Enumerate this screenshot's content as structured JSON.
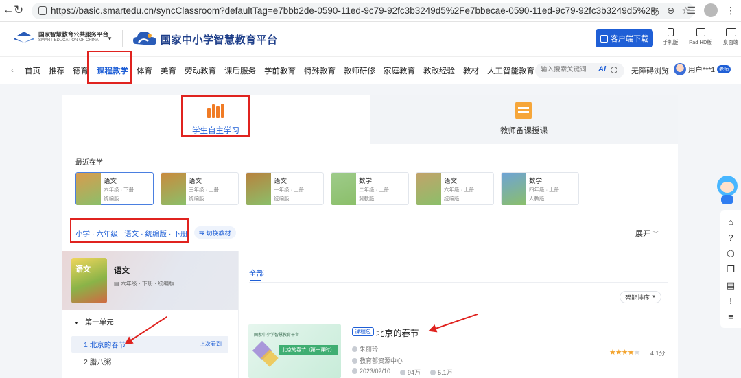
{
  "browser": {
    "url": "https://basic.smartedu.cn/syncClassroom?defaultTag=e7bbb2de-0590-11ed-9c79-92fc3b3249d5%2Fe7bbecae-0590-11ed-9c79-92fc3b3249d5%2F6a7496..."
  },
  "header": {
    "small_logo_cn": "国家智慧教育公共服务平台",
    "small_logo_en": "SMART EDUCATION OF CHINA",
    "main_title": "国家中小学智慧教育平台",
    "download_label": "客户端下载",
    "devices": [
      {
        "label": "手机版"
      },
      {
        "label": "Pad HD版"
      },
      {
        "label": "桌面端"
      }
    ]
  },
  "nav": {
    "items": [
      "首页",
      "推荐",
      "德育",
      "课程教学",
      "体育",
      "美育",
      "劳动教育",
      "课后服务",
      "学前教育",
      "特殊教育",
      "教师研修",
      "家庭教育",
      "教改经验",
      "教材",
      "人工智能教育"
    ],
    "active_index": 3,
    "search_placeholder": "输入搜索关键词",
    "ai_label": "Ai",
    "accessibility": "无障碍浏览",
    "user_name": "用户***1",
    "user_badge": "老师"
  },
  "tabs": {
    "student": "学生自主学习",
    "teacher": "教师备课授课"
  },
  "recent": {
    "title": "最近在学",
    "items": [
      {
        "subject": "语文",
        "grade": "六年级 · 下册",
        "edition": "统编版",
        "color": "#d99b4e"
      },
      {
        "subject": "语文",
        "grade": "三年级 · 上册",
        "edition": "统编版",
        "color": "#c98a3d"
      },
      {
        "subject": "语文",
        "grade": "一年级 · 上册",
        "edition": "统编版",
        "color": "#b8823e"
      },
      {
        "subject": "数学",
        "grade": "二年级 · 上册",
        "edition": "冀教版",
        "color": "#9ecb8a"
      },
      {
        "subject": "语文",
        "grade": "六年级 · 上册",
        "edition": "统编版",
        "color": "#c2a36a"
      },
      {
        "subject": "数学",
        "grade": "四年级 · 上册",
        "edition": "人教版",
        "color": "#6ea3d6"
      }
    ]
  },
  "filter": {
    "crumb": "小学 · 六年级 · 语文 · 统编版 · 下册",
    "switch_label": "切换教材",
    "expand_label": "展开"
  },
  "book": {
    "cover_text": "语文",
    "subject": "语文",
    "meta": "六年级 · 下册 · 统编版",
    "unit": "第一单元",
    "lessons": [
      {
        "label": "1 北京的春节",
        "last": "上次看到"
      },
      {
        "label": "2 腊八粥"
      }
    ]
  },
  "results": {
    "tab_all": "全部",
    "sort_label": "智能排序",
    "items": [
      {
        "tag": "课程包",
        "title": "北京的春节",
        "author": "朱丽玲",
        "org": "教育部资源中心",
        "date": "2023/02/10",
        "views": "94万",
        "likes": "5.1万",
        "rating_text": "4.1分",
        "rating": 4.1,
        "thumb_header": "国家中小学智慧教育平台",
        "thumb_title": "北京的春节（第一课时）"
      }
    ]
  },
  "colors": {
    "brand": "#1f5fd6",
    "annotation": "#e0231f"
  }
}
